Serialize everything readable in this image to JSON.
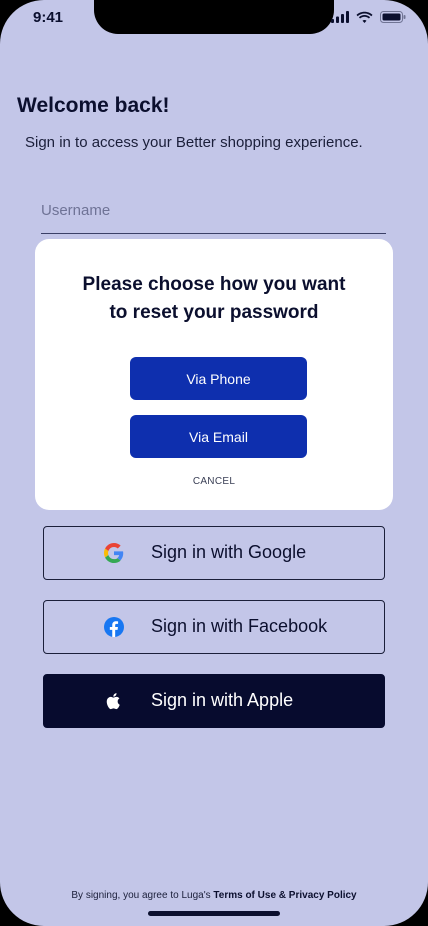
{
  "status_bar": {
    "time": "9:41"
  },
  "welcome": {
    "title": "Welcome back!",
    "subtitle": "Sign in to access your Better shopping experience."
  },
  "username_field": {
    "placeholder": "Username"
  },
  "reset_modal": {
    "title_line1": "Please choose how you want",
    "title_line2": "to reset your password",
    "phone_label": "Via Phone",
    "email_label": "Via Email",
    "cancel_label": "CANCEL"
  },
  "social_buttons": [
    {
      "label": "Sign in with Google",
      "icon": "google-icon"
    },
    {
      "label": "Sign in with Facebook",
      "icon": "facebook-icon"
    },
    {
      "label": "Sign in with Apple",
      "icon": "apple-icon"
    }
  ],
  "footer": {
    "prefix": "By signing, you agree to Luga's ",
    "terms": "Terms of Use",
    "joiner": " & ",
    "privacy": "Privacy Policy"
  },
  "colors": {
    "background": "#c3c6e8",
    "primary_button": "#0e2fae",
    "apple_button": "#070b2e",
    "text_dark": "#0b0f2e"
  }
}
